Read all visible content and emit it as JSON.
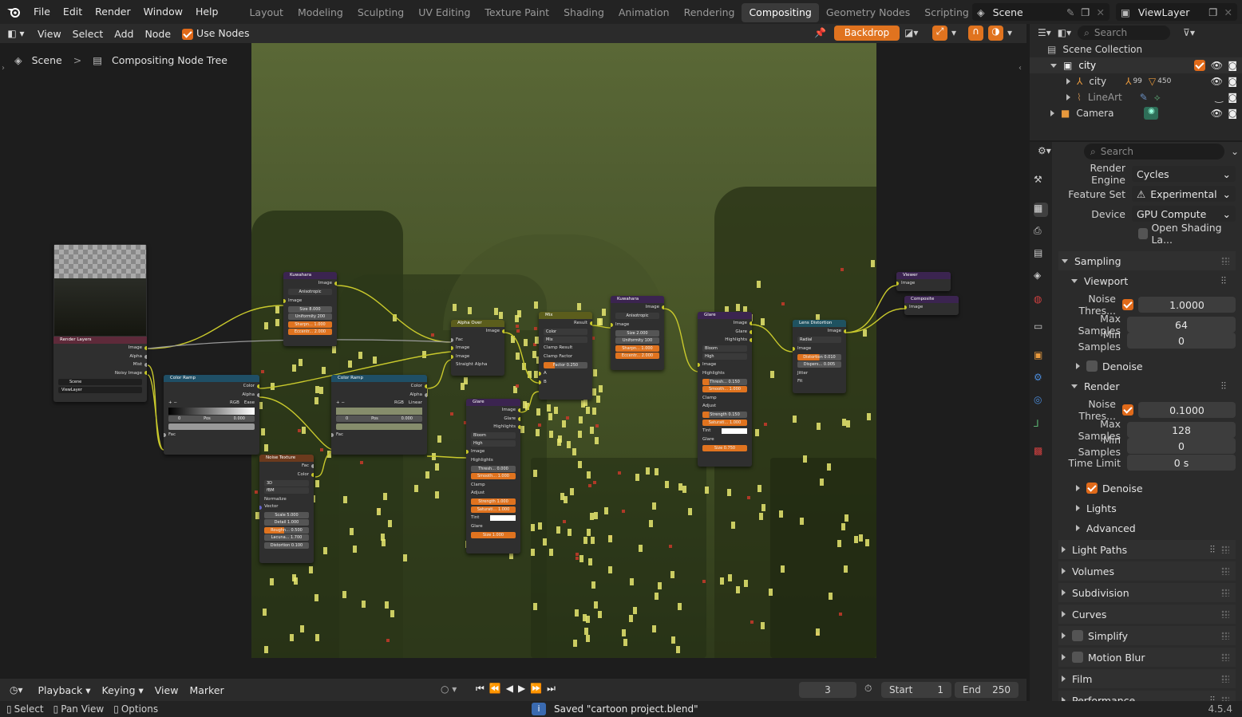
{
  "topbar": {
    "menus": [
      "File",
      "Edit",
      "Render",
      "Window",
      "Help"
    ],
    "workspaces": [
      "Layout",
      "Modeling",
      "Sculpting",
      "UV Editing",
      "Texture Paint",
      "Shading",
      "Animation",
      "Rendering",
      "Compositing",
      "Geometry Nodes",
      "Scripting"
    ],
    "active_workspace": "Compositing",
    "add_tab": "+",
    "scene": "Scene",
    "view_layer": "ViewLayer"
  },
  "node_header": {
    "menus": [
      "View",
      "Select",
      "Add",
      "Node"
    ],
    "use_nodes_label": "Use Nodes",
    "backdrop_label": "Backdrop"
  },
  "breadcrumb": {
    "scene": "Scene",
    "separator": ">",
    "tree": "Compositing Node Tree"
  },
  "nodes": {
    "render_layers": {
      "title": "Render Layers",
      "outputs": [
        "Image",
        "Alpha",
        "Mist",
        "Noisy Image"
      ],
      "scene": "Scene",
      "view_layer": "ViewLayer"
    },
    "kuwahara1": {
      "title": "Kuwahara",
      "out": "Image",
      "mode": "Anisotropic",
      "in": "Image",
      "fields": [
        [
          "Size",
          "8.000"
        ],
        [
          "Uniformity",
          "200"
        ],
        [
          "Sharpn...",
          "1.000"
        ],
        [
          "Eccentr...",
          "2.000"
        ]
      ]
    },
    "color_ramp1": {
      "title": "Color Ramp",
      "outs": [
        "Color",
        "Alpha"
      ],
      "mode": "RGB",
      "interp": "Ease",
      "pos_index": "0",
      "pos_label": "Pos",
      "pos_val": "0.000",
      "fac": "Fac"
    },
    "color_ramp2": {
      "title": "Color Ramp",
      "outs": [
        "Color",
        "Alpha"
      ],
      "mode": "RGB",
      "interp": "Linear",
      "pos_index": "0",
      "pos_label": "Pos",
      "pos_val": "0.000",
      "fac": "Fac"
    },
    "noise": {
      "title": "Noise Texture",
      "outs": [
        "Fac",
        "Color"
      ],
      "dim": "3D",
      "type": "fBM",
      "normalize": "Normalize",
      "vector": "Vector",
      "fields": [
        [
          "Scale",
          "5.000"
        ],
        [
          "Detail",
          "1.000"
        ],
        [
          "Roughn...",
          "0.500"
        ],
        [
          "Lacuna...",
          "1.700"
        ],
        [
          "Distortion",
          "0.100"
        ]
      ]
    },
    "alpha_over": {
      "title": "Alpha Over",
      "out": "Image",
      "ins": [
        "Fac",
        "Image",
        "Image"
      ],
      "straight": "Straight Alpha"
    },
    "glare1": {
      "title": "Glare",
      "outs": [
        "Image",
        "Glare",
        "Highlights"
      ],
      "type": "Bloom",
      "quality": "High",
      "in": "Image",
      "highlights": "Highlights",
      "thresh": [
        "Thresh...",
        "0.000"
      ],
      "smooth": [
        "Smooth...",
        "1.000"
      ],
      "clamp": "Clamp",
      "adjust": "Adjust",
      "strength": [
        "Strength",
        "1.000"
      ],
      "saturation": [
        "Saturati...",
        "1.000"
      ],
      "tint": "Tint",
      "glare": "Glare",
      "size": [
        "Size",
        "1.000"
      ]
    },
    "mix": {
      "title": "Mix",
      "out": "Result",
      "type": "Color",
      "blend": "Mix",
      "clamp_result": "Clamp Result",
      "clamp_factor": "Clamp Factor",
      "factor": [
        "Factor",
        "0.250"
      ],
      "a": "A",
      "b": "B"
    },
    "kuwahara2": {
      "title": "Kuwahara",
      "out": "Image",
      "mode": "Anisotropic",
      "in": "Image",
      "fields": [
        [
          "Size",
          "2.000"
        ],
        [
          "Uniformity",
          "100"
        ],
        [
          "Sharpn...",
          "1.000"
        ],
        [
          "Eccentr...",
          "2.000"
        ]
      ]
    },
    "glare2": {
      "title": "Glare",
      "outs": [
        "Image",
        "Glare",
        "Highlights"
      ],
      "type": "Bloom",
      "quality": "High",
      "in": "Image",
      "highlights": "Highlights",
      "thresh": [
        "Thresh...",
        "0.150"
      ],
      "smooth": [
        "Smooth...",
        "1.000"
      ],
      "clamp": "Clamp",
      "adjust": "Adjust",
      "strength": [
        "Strength",
        "0.150"
      ],
      "saturation": [
        "Saturati...",
        "1.000"
      ],
      "tint": "Tint",
      "glare": "Glare",
      "size": [
        "Size",
        "0.750"
      ]
    },
    "lens": {
      "title": "Lens Distortion",
      "out": "Image",
      "mode": "Radial",
      "in": "Image",
      "fields": [
        [
          "Distortion",
          "0.010"
        ],
        [
          "Dispers...",
          "0.005"
        ]
      ],
      "jitter": "Jitter",
      "fit": "Fit"
    },
    "viewer": {
      "title": "Viewer",
      "in": "Image"
    },
    "composite": {
      "title": "Composite",
      "in": "Image"
    }
  },
  "outliner": {
    "search_placeholder": "Search",
    "root": "Scene Collection",
    "items": [
      {
        "label": "city",
        "level": 1
      },
      {
        "label": "city",
        "level": 2,
        "badge1": "99",
        "badge2": "450"
      },
      {
        "label": "LineArt",
        "level": 2
      },
      {
        "label": "Camera",
        "level": 1
      }
    ]
  },
  "properties": {
    "search_placeholder": "Search",
    "render_engine": {
      "label": "Render Engine",
      "value": "Cycles"
    },
    "feature_set": {
      "label": "Feature Set",
      "value": "Experimental"
    },
    "device": {
      "label": "Device",
      "value": "GPU Compute"
    },
    "osl": "Open Shading La...",
    "sampling": "Sampling",
    "viewport": "Viewport",
    "vp_noise": {
      "label": "Noise Thres...",
      "value": "1.0000"
    },
    "vp_max": {
      "label": "Max Samples",
      "value": "64"
    },
    "vp_min": {
      "label": "Min Samples",
      "value": "0"
    },
    "vp_denoise": "Denoise",
    "render": "Render",
    "r_noise": {
      "label": "Noise Thres...",
      "value": "0.1000"
    },
    "r_max": {
      "label": "Max Samples",
      "value": "128"
    },
    "r_min": {
      "label": "Min Samples",
      "value": "0"
    },
    "r_time": {
      "label": "Time Limit",
      "value": "0 s"
    },
    "r_denoise": "Denoise",
    "lights": "Lights",
    "advanced": "Advanced",
    "sections": [
      "Light Paths",
      "Volumes",
      "Subdivision",
      "Curves",
      "Simplify",
      "Motion Blur",
      "Film",
      "Performance"
    ]
  },
  "timeline": {
    "menus": [
      "Playback",
      "Keying",
      "View",
      "Marker"
    ],
    "frame": "3",
    "start_label": "Start",
    "start": "1",
    "end_label": "End",
    "end": "250"
  },
  "statusbar": {
    "select": "Select",
    "pan": "Pan View",
    "options": "Options",
    "message": "Saved \"cartoon project.blend\"",
    "version": "4.5.4"
  },
  "colors": {
    "accent": "#e06a1a",
    "active_tab": "#3a3a3a",
    "link": "#c7c729",
    "kuwahara_header": "#3b2450",
    "color_ramp_header": "#1f4f66",
    "noise_header": "#6b3a1d",
    "alpha_over_header": "#5b5d1c",
    "lens_header": "#1f5260"
  }
}
